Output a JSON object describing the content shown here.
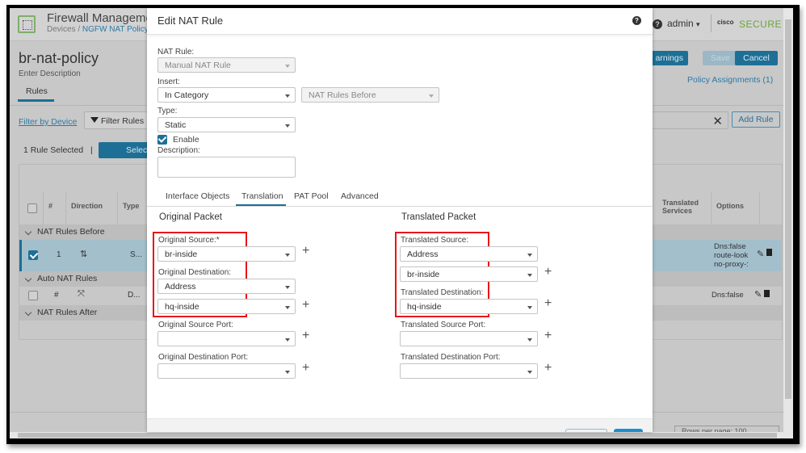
{
  "app": {
    "title": "Firewall Management",
    "breadcrumb": [
      "Devices",
      "/",
      "NGFW NAT Policy"
    ],
    "user": "admin",
    "user_caret": "▾",
    "brand_small": "cisco",
    "brand": "SECURE",
    "help": "?"
  },
  "policy": {
    "name": "br-nat-policy",
    "description": "Enter Description",
    "tab": "Rules",
    "warnings_button": "arnings",
    "save_button": "Save",
    "cancel_button": "Cancel",
    "policy_assignments": "Policy Assignments (1)",
    "filter_by_device": "Filter by Device",
    "filter_rules": "Filter Rules",
    "rule_selected": "1 Rule Selected",
    "separator": "|",
    "select_button": "Selec",
    "search_clear": "✕",
    "add_rule": "Add Rule",
    "rows_per_page": "Rows per page: 100"
  },
  "table": {
    "headers": {
      "num": "#",
      "direction": "Direction",
      "type": "Type",
      "translated_services": "Translated Services",
      "options": "Options"
    },
    "groups": [
      "NAT Rules Before",
      "Auto NAT Rules",
      "NAT Rules After"
    ],
    "rows": [
      {
        "selected": true,
        "num": "1",
        "direction_icon": "bidirectional-arrows-icon",
        "type": "S...",
        "options": [
          "Dns:false",
          "route-look",
          "no-proxy-:"
        ]
      },
      {
        "selected": false,
        "num": "#",
        "direction_icon": "unidirectional-arrow-icon",
        "type": "D...",
        "options": [
          "Dns:false"
        ]
      }
    ]
  },
  "modal": {
    "title": "Edit NAT Rule",
    "help": "?",
    "nat_rule": {
      "label": "NAT Rule:",
      "value": "Manual NAT Rule"
    },
    "insert": {
      "label": "Insert:",
      "value": "In Category",
      "category": "NAT Rules Before"
    },
    "type": {
      "label": "Type:",
      "value": "Static"
    },
    "enable": {
      "label": "Enable",
      "checked": true
    },
    "description": {
      "label": "Description:",
      "value": ""
    },
    "tabs": [
      "Interface Objects",
      "Translation",
      "PAT Pool",
      "Advanced"
    ],
    "active_tab": "Translation",
    "original": {
      "heading": "Original Packet",
      "source_label": "Original Source:*",
      "source": "br-inside",
      "dest_label": "Original Destination:",
      "dest_type": "Address",
      "dest": "hq-inside",
      "src_port_label": "Original Source Port:",
      "src_port": "",
      "dst_port_label": "Original Destination Port:",
      "dst_port": ""
    },
    "translated": {
      "heading": "Translated Packet",
      "source_label": "Translated Source:",
      "source_type": "Address",
      "source": "br-inside",
      "dest_label": "Translated Destination:",
      "dest": "hq-inside",
      "src_port_label": "Translated Source Port:",
      "src_port": "",
      "dst_port_label": "Translated Destination Port:",
      "dst_port": ""
    },
    "plus": "+"
  },
  "colors": {
    "accent": "#1d6f95",
    "highlight": "#e8141a",
    "selected_row": "#a3bfcc",
    "brand_green": "#6ba539"
  }
}
